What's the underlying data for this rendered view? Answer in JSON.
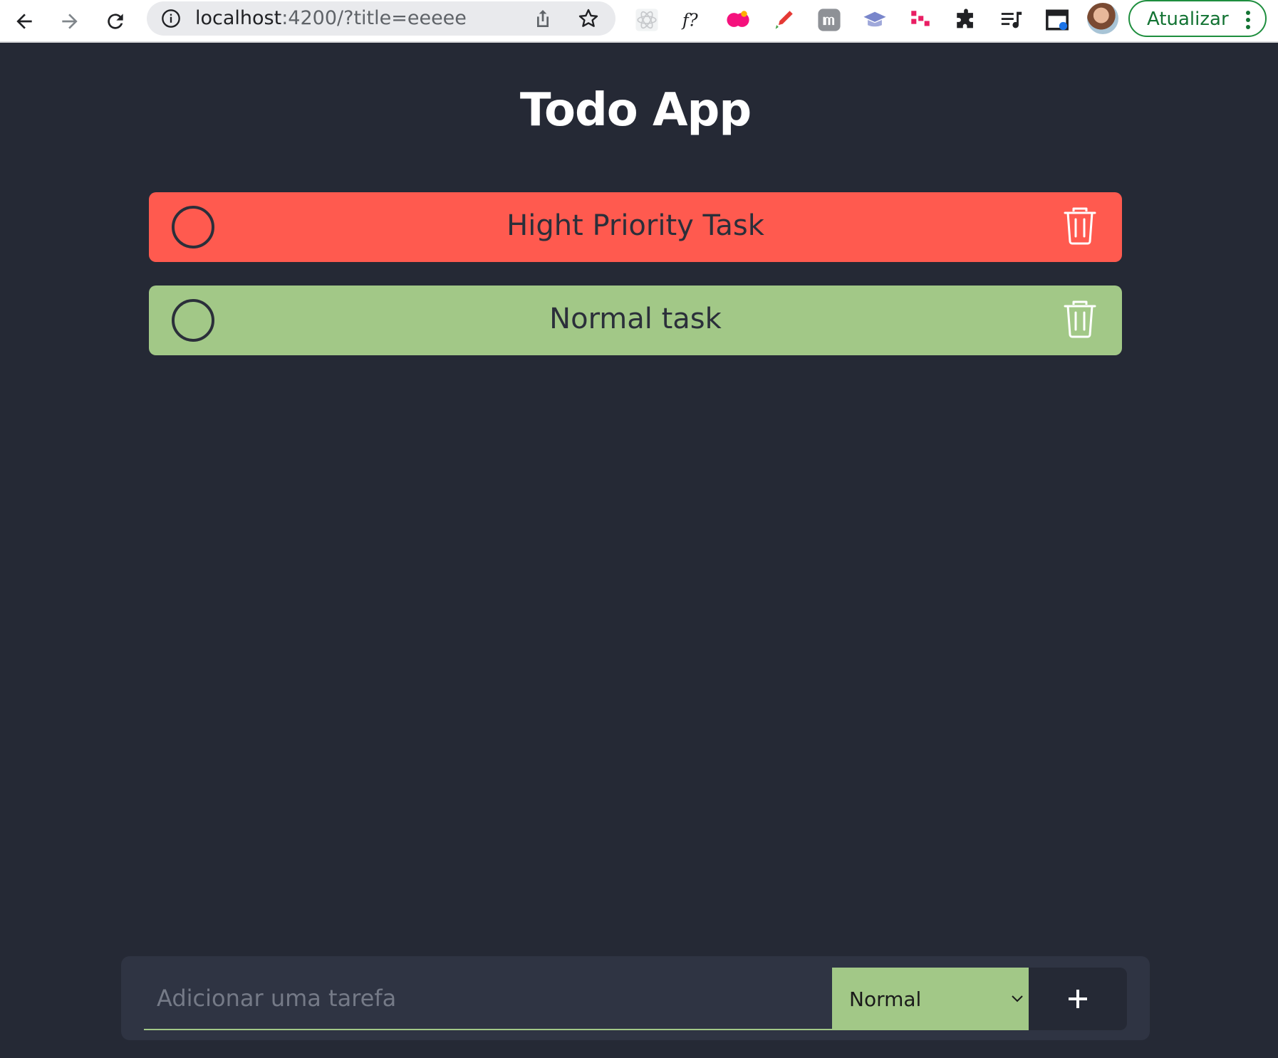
{
  "browser": {
    "url_host": "localhost",
    "url_path": ":4200/?title=eeeee",
    "update_label": "Atualizar",
    "extensions": [
      "react-devtools-icon",
      "function-icon",
      "livelo-icon",
      "color-picker-icon",
      "m-icon",
      "graduation-cap-icon",
      "grid-icon",
      "puzzle-icon",
      "playlist-icon",
      "window-icon"
    ]
  },
  "app": {
    "title": "Todo App",
    "tasks": [
      {
        "title": "Hight Priority Task",
        "priority": "high",
        "color": "#ff5a4f"
      },
      {
        "title": "Normal task",
        "priority": "normal",
        "color": "#a2c887"
      }
    ],
    "form": {
      "placeholder": "Adicionar uma tarefa",
      "selected_priority": "Normal",
      "add_label": "+"
    }
  },
  "colors": {
    "background": "#252935",
    "high": "#ff5a4f",
    "normal": "#a2c887",
    "update_green": "#137333"
  }
}
